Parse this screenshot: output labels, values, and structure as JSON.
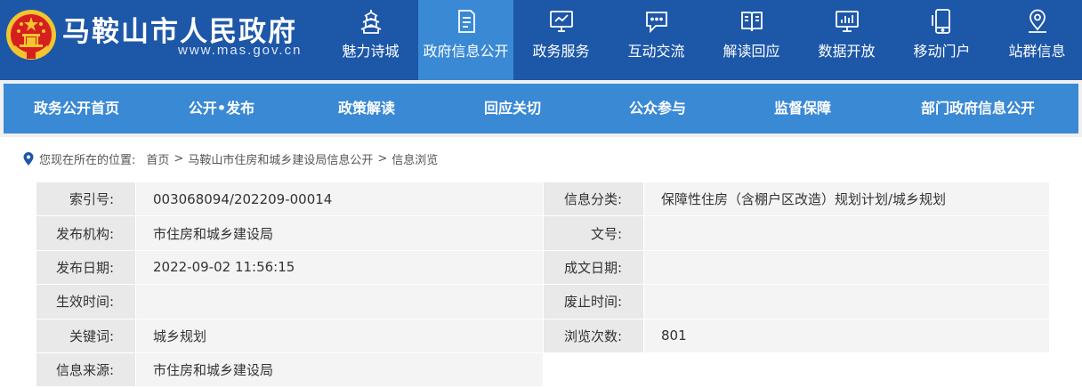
{
  "site": {
    "title": "马鞍山市人民政府",
    "url": "www.mas.gov.cn"
  },
  "top_nav": [
    {
      "label": "魅力诗城",
      "icon": "pagoda-icon",
      "active": false
    },
    {
      "label": "政府信息公开",
      "icon": "document-icon",
      "active": true
    },
    {
      "label": "政务服务",
      "icon": "monitor-icon",
      "active": false
    },
    {
      "label": "互动交流",
      "icon": "chat-bubble-icon",
      "active": false
    },
    {
      "label": "解读回应",
      "icon": "open-book-icon",
      "active": false
    },
    {
      "label": "数据开放",
      "icon": "chart-screen-icon",
      "active": false
    },
    {
      "label": "移动门户",
      "icon": "mobile-phone-icon",
      "active": false
    },
    {
      "label": "站群信息",
      "icon": "location-pin-icon",
      "active": false
    }
  ],
  "sub_nav": [
    "政务公开首页",
    "公开•发布",
    "政策解读",
    "回应关切",
    "公众参与",
    "监督保障",
    "部门政府信息公开"
  ],
  "breadcrumb": {
    "prefix": "您现在所在的位置:",
    "items": [
      "首页",
      "马鞍山市住房和城乡建设局信息公开",
      "信息浏览"
    ],
    "separator": ">"
  },
  "info": {
    "index_no_label": "索引号:",
    "index_no": "003068094/202209-00014",
    "category_label": "信息分类:",
    "category": "保障性住房（含棚户区改造）规划计划/城乡规划",
    "publisher_label": "发布机构:",
    "publisher": "市住房和城乡建设局",
    "doc_no_label": "文号:",
    "doc_no": "",
    "publish_date_label": "发布日期:",
    "publish_date": "2022-09-02 11:56:15",
    "written_date_label": "成文日期:",
    "written_date": "",
    "effective_label": "生效时间:",
    "effective": "",
    "expire_label": "废止时间:",
    "expire": "",
    "keywords_label": "关键词:",
    "keywords": "城乡规划",
    "views_label": "浏览次数:",
    "views": "801",
    "source_label": "信息来源:",
    "source": "市住房和城乡建设局"
  },
  "colors": {
    "header_bg": "#1d57a8",
    "nav_active": "#3a89d4",
    "subnav_bg": "#3a89d4",
    "emblem_red": "#d61f1f",
    "emblem_gold": "#f3c530",
    "pin": "#1d57a8"
  }
}
